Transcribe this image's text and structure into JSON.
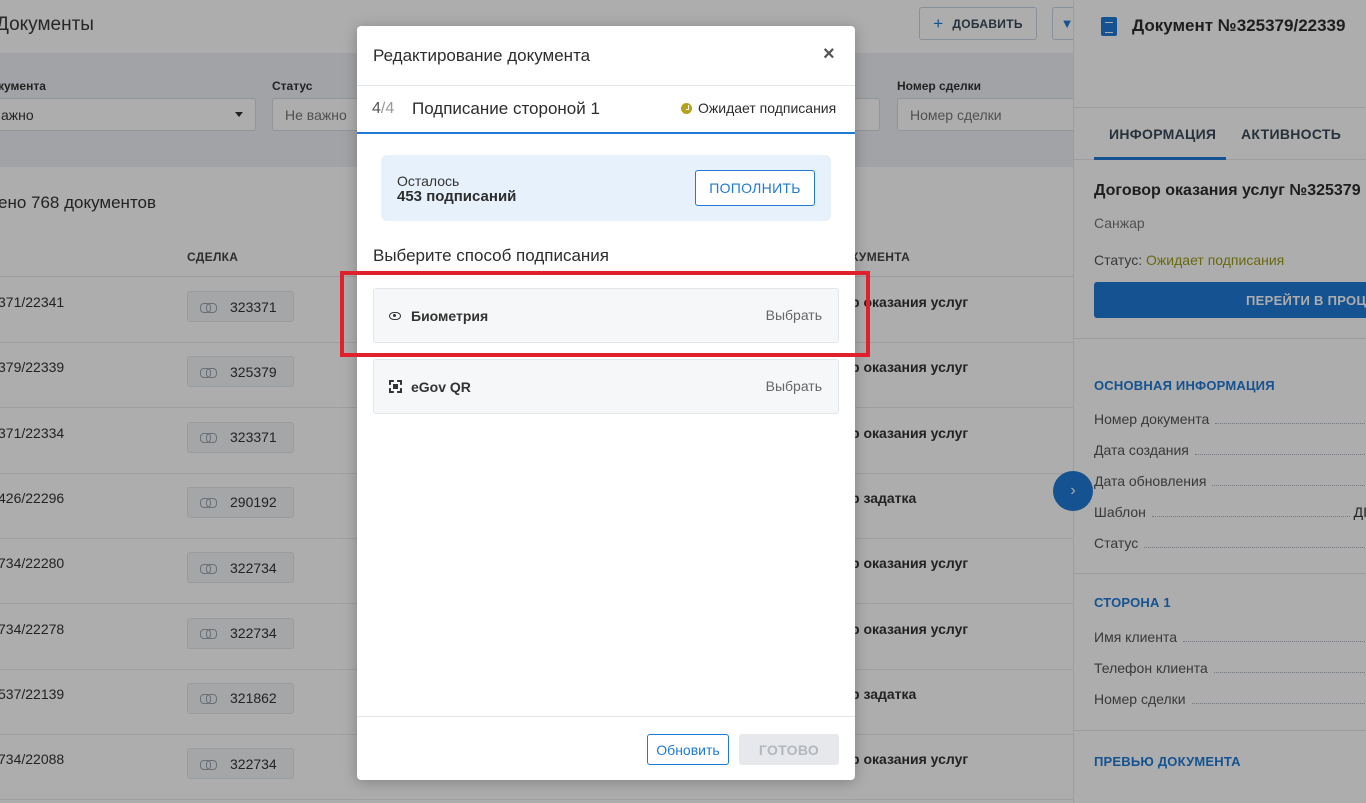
{
  "page": {
    "title": "Документы",
    "add_label": "ДОБАВИТЬ",
    "filter_icon": "filter-icon"
  },
  "filters": {
    "doc_type_label": "кумента",
    "doc_type_value": "ажно",
    "status_label": "Статус",
    "status_value": "Не важно",
    "deal_label": "Номер сделки",
    "deal_placeholder": "Номер сделки"
  },
  "summary": {
    "count_text": "ено 768 документов"
  },
  "table": {
    "headers": {
      "deal": "СДЕЛКА",
      "type": "КУМЕНТА"
    },
    "rows": [
      {
        "num": "371/22341",
        "deal": "323371",
        "type": "р оказания услуг"
      },
      {
        "num": "379/22339",
        "deal": "325379",
        "type": "р оказания услуг"
      },
      {
        "num": "371/22334",
        "deal": "323371",
        "type": "р оказания услуг"
      },
      {
        "num": "426/22296",
        "deal": "290192",
        "type": "р задатка"
      },
      {
        "num": "734/22280",
        "deal": "322734",
        "type": "р оказания услуг"
      },
      {
        "num": "734/22278",
        "deal": "322734",
        "type": "р оказания услуг"
      },
      {
        "num": "537/22139",
        "deal": "321862",
        "type": "р задатка"
      },
      {
        "num": "734/22088",
        "deal": "322734",
        "type": "р оказания услуг"
      }
    ]
  },
  "side_panel": {
    "title": "Документ №325379/22339",
    "tabs": [
      "ИНФОРМАЦИЯ",
      "АКТИВНОСТЬ"
    ],
    "doc_name": "Договор оказания услуг №325379",
    "client": "Санжар",
    "status_label": "Статус:",
    "status_value": "Ожидает подписания",
    "action_button": "ПЕРЕЙТИ В ПРОЦ",
    "section_main": "ОСНОВНАЯ ИНФОРМАЦИЯ",
    "main_fields": [
      "Номер документа",
      "Дата создания",
      "Дата обновления",
      "Шаблон",
      "Статус"
    ],
    "template_value": "ДІ",
    "section_party": "СТОРОНА 1",
    "party_fields": [
      "Имя клиента",
      "Телефон клиента",
      "Номер сделки"
    ],
    "section_preview": "ПРЕВЬЮ ДОКУМЕНТА",
    "collapse_icon": "›"
  },
  "modal": {
    "title": "Редактирование документа",
    "close": "×",
    "step_current": "4",
    "step_total": "/4",
    "step_title": "Подписание стороной 1",
    "step_status": "Ожидает подписания",
    "balance_label": "Осталось",
    "balance_value": "453 подписаний",
    "balance_button": "ПОПОЛНИТЬ",
    "choose_title": "Выберите способ подписания",
    "methods": [
      {
        "name": "Биометрия",
        "action": "Выбрать",
        "icon": "eye-icon"
      },
      {
        "name": "eGov QR",
        "action": "Выбрать",
        "icon": "qr-icon"
      }
    ],
    "refresh_button": "Обновить",
    "done_button": "ГОТОВО"
  },
  "colors": {
    "accent": "#1e7ad6",
    "status_pending": "#b5a11a",
    "highlight": "#e0202a"
  }
}
